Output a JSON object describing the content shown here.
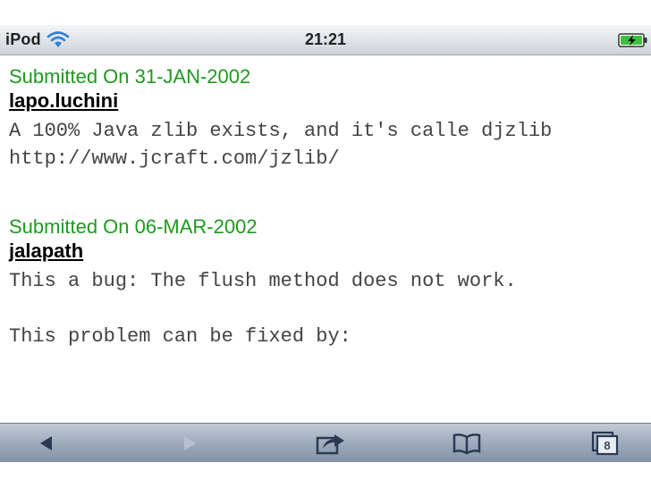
{
  "status_bar": {
    "device": "iPod",
    "time": "21:21"
  },
  "entries": [
    {
      "submitted": "Submitted On 31-JAN-2002",
      "author": "lapo.luchini",
      "body": "A 100% Java zlib exists, and it's calle djzlib\nhttp://www.jcraft.com/jzlib/"
    },
    {
      "submitted": "Submitted On 06-MAR-2002",
      "author": "jalapath",
      "body": "This a bug: The flush method does not work.\n\nThis problem can be fixed by:"
    }
  ],
  "toolbar": {
    "pages_count": "8",
    "icons": [
      "back-arrow-icon",
      "forward-arrow-icon",
      "share-icon",
      "bookmarks-icon",
      "pages-icon"
    ]
  },
  "colors": {
    "submitted_text": "#1f9a1f",
    "body_text": "#444444",
    "toolbar": "#9eabbd"
  }
}
